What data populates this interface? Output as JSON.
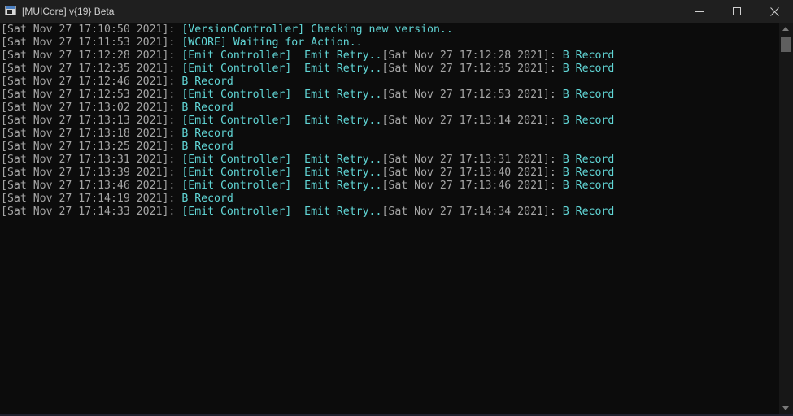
{
  "window": {
    "title": "[MUICore] v{19} Beta"
  },
  "colors": {
    "background": "#0c0c0c",
    "timestamp": "#a6a6a6",
    "message": "#61d6d6",
    "titlebar": "#1f1f1f"
  },
  "icons": {
    "app": "console-app-icon",
    "minimize": "minimize-icon",
    "maximize": "maximize-icon",
    "close": "close-icon"
  },
  "log": [
    [
      {
        "t": "ts",
        "s": "[Sat Nov 27 17:10:50 2021]: "
      },
      {
        "t": "msg",
        "s": "[VersionController] Checking new version.."
      }
    ],
    [
      {
        "t": "ts",
        "s": "[Sat Nov 27 17:11:53 2021]: "
      },
      {
        "t": "msg",
        "s": "[WCORE] Waiting for Action.."
      }
    ],
    [
      {
        "t": "ts",
        "s": "[Sat Nov 27 17:12:28 2021]: "
      },
      {
        "t": "msg",
        "s": "[Emit Controller]  Emit Retry.."
      },
      {
        "t": "ts",
        "s": "[Sat Nov 27 17:12:28 2021]: "
      },
      {
        "t": "msg",
        "s": "B Record"
      }
    ],
    [
      {
        "t": "ts",
        "s": "[Sat Nov 27 17:12:35 2021]: "
      },
      {
        "t": "msg",
        "s": "[Emit Controller]  Emit Retry.."
      },
      {
        "t": "ts",
        "s": "[Sat Nov 27 17:12:35 2021]: "
      },
      {
        "t": "msg",
        "s": "B Record"
      }
    ],
    [
      {
        "t": "ts",
        "s": "[Sat Nov 27 17:12:46 2021]: "
      },
      {
        "t": "msg",
        "s": "B Record"
      }
    ],
    [
      {
        "t": "ts",
        "s": "[Sat Nov 27 17:12:53 2021]: "
      },
      {
        "t": "msg",
        "s": "[Emit Controller]  Emit Retry.."
      },
      {
        "t": "ts",
        "s": "[Sat Nov 27 17:12:53 2021]: "
      },
      {
        "t": "msg",
        "s": "B Record"
      }
    ],
    [
      {
        "t": "ts",
        "s": "[Sat Nov 27 17:13:02 2021]: "
      },
      {
        "t": "msg",
        "s": "B Record"
      }
    ],
    [
      {
        "t": "ts",
        "s": "[Sat Nov 27 17:13:13 2021]: "
      },
      {
        "t": "msg",
        "s": "[Emit Controller]  Emit Retry.."
      },
      {
        "t": "ts",
        "s": "[Sat Nov 27 17:13:14 2021]: "
      },
      {
        "t": "msg",
        "s": "B Record"
      }
    ],
    [
      {
        "t": "ts",
        "s": "[Sat Nov 27 17:13:18 2021]: "
      },
      {
        "t": "msg",
        "s": "B Record"
      }
    ],
    [
      {
        "t": "ts",
        "s": "[Sat Nov 27 17:13:25 2021]: "
      },
      {
        "t": "msg",
        "s": "B Record"
      }
    ],
    [
      {
        "t": "ts",
        "s": "[Sat Nov 27 17:13:31 2021]: "
      },
      {
        "t": "msg",
        "s": "[Emit Controller]  Emit Retry.."
      },
      {
        "t": "ts",
        "s": "[Sat Nov 27 17:13:31 2021]: "
      },
      {
        "t": "msg",
        "s": "B Record"
      }
    ],
    [
      {
        "t": "ts",
        "s": "[Sat Nov 27 17:13:39 2021]: "
      },
      {
        "t": "msg",
        "s": "[Emit Controller]  Emit Retry.."
      },
      {
        "t": "ts",
        "s": "[Sat Nov 27 17:13:40 2021]: "
      },
      {
        "t": "msg",
        "s": "B Record"
      }
    ],
    [
      {
        "t": "ts",
        "s": "[Sat Nov 27 17:13:46 2021]: "
      },
      {
        "t": "msg",
        "s": "[Emit Controller]  Emit Retry.."
      },
      {
        "t": "ts",
        "s": "[Sat Nov 27 17:13:46 2021]: "
      },
      {
        "t": "msg",
        "s": "B Record"
      }
    ],
    [
      {
        "t": "ts",
        "s": "[Sat Nov 27 17:14:19 2021]: "
      },
      {
        "t": "msg",
        "s": "B Record"
      }
    ],
    [
      {
        "t": "ts",
        "s": "[Sat Nov 27 17:14:33 2021]: "
      },
      {
        "t": "msg",
        "s": "[Emit Controller]  Emit Retry.."
      },
      {
        "t": "ts",
        "s": "[Sat Nov 27 17:14:34 2021]: "
      },
      {
        "t": "msg",
        "s": "B Record"
      }
    ]
  ]
}
